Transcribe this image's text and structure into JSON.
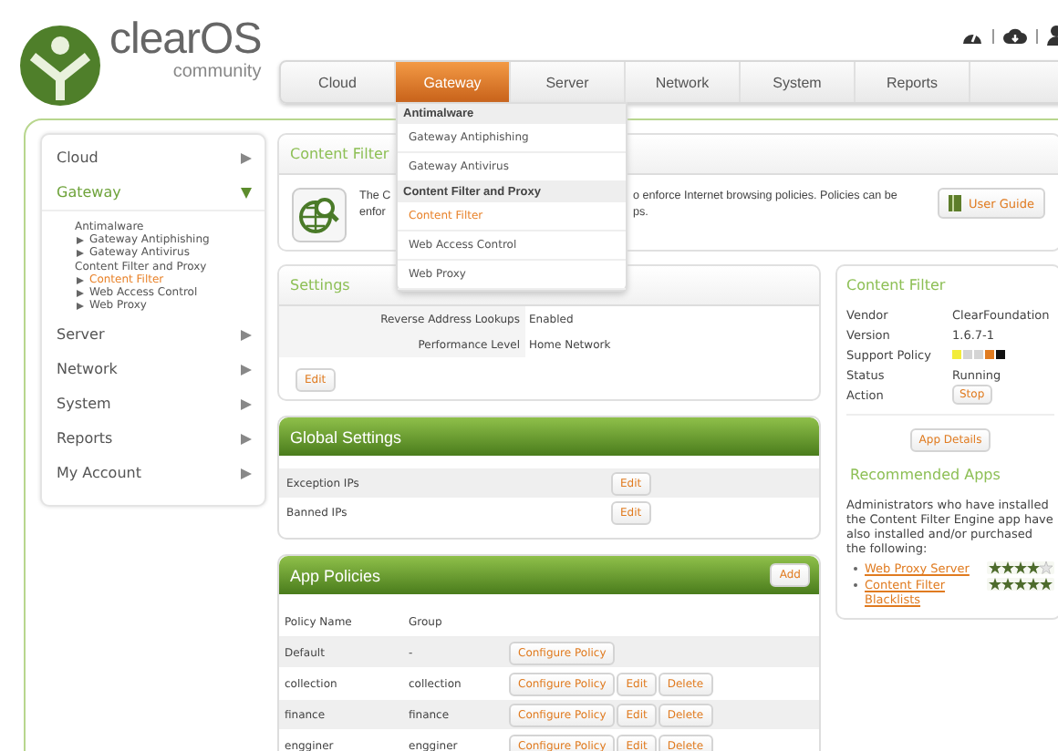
{
  "logo": {
    "name": "clearOS",
    "edition": "community"
  },
  "nav_tabs": [
    {
      "label": "Cloud",
      "selected": false
    },
    {
      "label": "Gateway",
      "selected": true
    },
    {
      "label": "Server",
      "selected": false
    },
    {
      "label": "Network",
      "selected": false
    },
    {
      "label": "System",
      "selected": false
    },
    {
      "label": "Reports",
      "selected": false
    }
  ],
  "dropdown": [
    {
      "kind": "header",
      "label": "Antimalware"
    },
    {
      "kind": "item",
      "label": "Gateway Antiphishing",
      "selected": false
    },
    {
      "kind": "item",
      "label": "Gateway Antivirus",
      "selected": false
    },
    {
      "kind": "header",
      "label": "Content Filter and Proxy"
    },
    {
      "kind": "item",
      "label": "Content Filter",
      "selected": true
    },
    {
      "kind": "item",
      "label": "Web Access Control",
      "selected": false
    },
    {
      "kind": "item",
      "label": "Web Proxy",
      "selected": false
    }
  ],
  "sidebar": [
    {
      "label": "Cloud",
      "expanded": false
    },
    {
      "label": "Gateway",
      "expanded": true,
      "groups": [
        {
          "label": "Antimalware",
          "items": [
            {
              "label": "Gateway Antiphishing",
              "selected": false
            },
            {
              "label": "Gateway Antivirus",
              "selected": false
            }
          ]
        },
        {
          "label": "Content Filter and Proxy",
          "items": [
            {
              "label": "Content Filter",
              "selected": true
            },
            {
              "label": "Web Access Control",
              "selected": false
            },
            {
              "label": "Web Proxy",
              "selected": false
            }
          ]
        }
      ]
    },
    {
      "label": "Server",
      "expanded": false
    },
    {
      "label": "Network",
      "expanded": false
    },
    {
      "label": "System",
      "expanded": false
    },
    {
      "label": "Reports",
      "expanded": false
    },
    {
      "label": "My Account",
      "expanded": false
    }
  ],
  "app_header": {
    "title": "Content Filter",
    "description_lines": [
      [
        "The C",
        "o enforce Internet browsing policies. Policies can be"
      ],
      [
        "enfor",
        "ps."
      ]
    ],
    "guide_button": "User Guide"
  },
  "settings": {
    "title": "Settings",
    "rows": [
      {
        "label": "Reverse Address Lookups",
        "value": "Enabled"
      },
      {
        "label": "Performance Level",
        "value": "Home Network"
      }
    ],
    "button": "Edit"
  },
  "global_settings": {
    "title": "Global Settings",
    "rows": [
      {
        "label": "Exception IPs",
        "button": "Edit"
      },
      {
        "label": "Banned IPs",
        "button": "Edit"
      }
    ]
  },
  "app_policies": {
    "title": "App Policies",
    "add_button": "Add",
    "columns": [
      "Policy Name",
      "Group"
    ],
    "rows": [
      {
        "name": "Default",
        "group": "-",
        "buttons": [
          "Configure Policy"
        ]
      },
      {
        "name": "collection",
        "group": "collection",
        "buttons": [
          "Configure Policy",
          "Edit",
          "Delete"
        ]
      },
      {
        "name": "finance",
        "group": "finance",
        "buttons": [
          "Configure Policy",
          "Edit",
          "Delete"
        ]
      },
      {
        "name": "engginer",
        "group": "engginer",
        "buttons": [
          "Configure Policy",
          "Edit",
          "Delete"
        ]
      }
    ]
  },
  "info": {
    "title": "Content Filter",
    "rows": [
      {
        "kind": "text",
        "label": "Vendor",
        "value": "ClearFoundation"
      },
      {
        "kind": "text",
        "label": "Version",
        "value": "1.6.7-1"
      },
      {
        "kind": "policy",
        "label": "Support Policy",
        "squares": [
          {
            "color": "#f2ec3a"
          },
          {
            "color": "#d4d4d4"
          },
          {
            "color": "#d4d4d4"
          },
          {
            "color": "#e07b20"
          },
          {
            "color": "#111111"
          }
        ]
      },
      {
        "kind": "text",
        "label": "Status",
        "value": "Running"
      },
      {
        "kind": "button",
        "label": "Action",
        "value": "Stop"
      }
    ],
    "details_button": "App Details",
    "recommended_title": "Recommended Apps",
    "recommended_text": "Administrators who have installed the Content Filter Engine app have also installed and/or purchased the following:",
    "recommended": [
      {
        "label": "Web Proxy Server",
        "stars": 4
      },
      {
        "label": "Content Filter Blacklists",
        "stars": 5
      }
    ]
  }
}
